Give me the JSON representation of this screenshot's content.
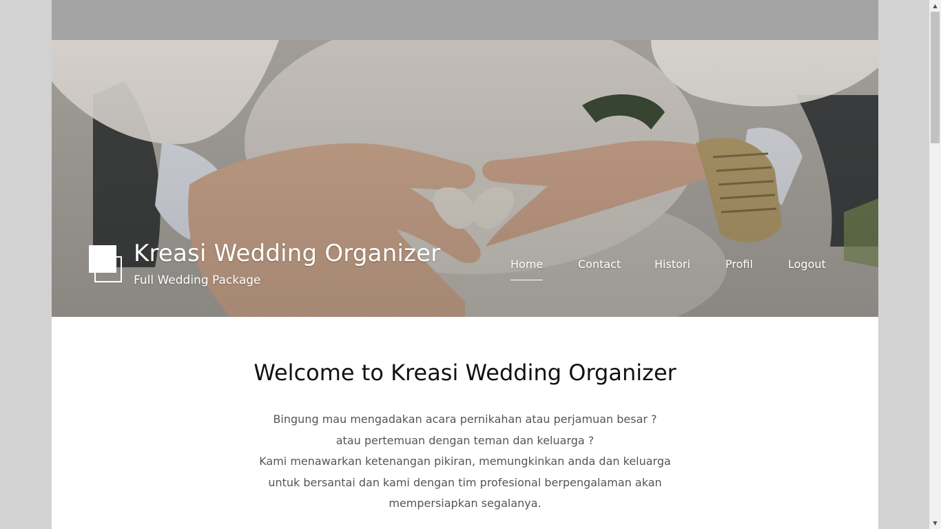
{
  "header": {
    "site_title": "Kreasi Wedding Organizer",
    "tagline": "Full Wedding Package"
  },
  "nav": {
    "items": [
      {
        "label": "Home",
        "active": true
      },
      {
        "label": "Contact",
        "active": false
      },
      {
        "label": "Histori",
        "active": false
      },
      {
        "label": "Profil",
        "active": false
      },
      {
        "label": "Logout",
        "active": false
      }
    ]
  },
  "main": {
    "heading": "Welcome to Kreasi Wedding Organizer",
    "intro_lines": [
      "Bingung mau mengadakan acara pernikahan atau perjamuan besar ?",
      "atau pertemuan dengan teman dan keluarga ?",
      "Kami menawarkan ketenangan pikiran, memungkinkan anda dan keluarga",
      "untuk bersantai dan kami dengan tim profesional berpengalaman akan",
      "mempersiapkan segalanya."
    ]
  },
  "colors": {
    "page_background": "#d2d2d2",
    "topbar": "#a4a4a4",
    "nav_text": "#ffffff",
    "heading_text": "#111111",
    "body_text": "#555555"
  },
  "icons": {
    "logo": "overlapping-squares-logo-icon",
    "scroll_up": "chevron-up-icon",
    "scroll_down": "chevron-down-icon"
  }
}
